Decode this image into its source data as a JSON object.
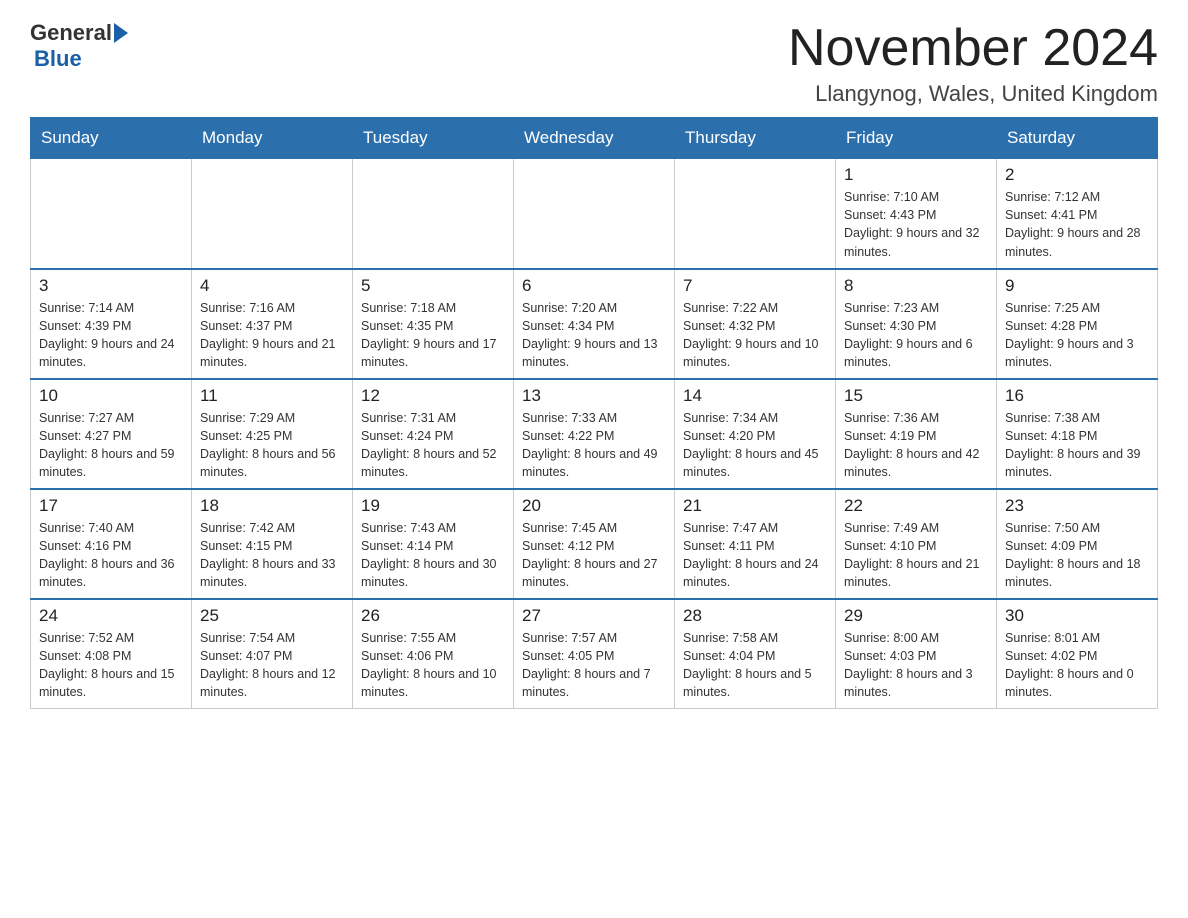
{
  "header": {
    "logo_general": "General",
    "logo_blue": "Blue",
    "month_title": "November 2024",
    "location": "Llangynog, Wales, United Kingdom"
  },
  "days_of_week": [
    "Sunday",
    "Monday",
    "Tuesday",
    "Wednesday",
    "Thursday",
    "Friday",
    "Saturday"
  ],
  "weeks": [
    [
      {
        "day": "",
        "info": ""
      },
      {
        "day": "",
        "info": ""
      },
      {
        "day": "",
        "info": ""
      },
      {
        "day": "",
        "info": ""
      },
      {
        "day": "",
        "info": ""
      },
      {
        "day": "1",
        "info": "Sunrise: 7:10 AM\nSunset: 4:43 PM\nDaylight: 9 hours and 32 minutes."
      },
      {
        "day": "2",
        "info": "Sunrise: 7:12 AM\nSunset: 4:41 PM\nDaylight: 9 hours and 28 minutes."
      }
    ],
    [
      {
        "day": "3",
        "info": "Sunrise: 7:14 AM\nSunset: 4:39 PM\nDaylight: 9 hours and 24 minutes."
      },
      {
        "day": "4",
        "info": "Sunrise: 7:16 AM\nSunset: 4:37 PM\nDaylight: 9 hours and 21 minutes."
      },
      {
        "day": "5",
        "info": "Sunrise: 7:18 AM\nSunset: 4:35 PM\nDaylight: 9 hours and 17 minutes."
      },
      {
        "day": "6",
        "info": "Sunrise: 7:20 AM\nSunset: 4:34 PM\nDaylight: 9 hours and 13 minutes."
      },
      {
        "day": "7",
        "info": "Sunrise: 7:22 AM\nSunset: 4:32 PM\nDaylight: 9 hours and 10 minutes."
      },
      {
        "day": "8",
        "info": "Sunrise: 7:23 AM\nSunset: 4:30 PM\nDaylight: 9 hours and 6 minutes."
      },
      {
        "day": "9",
        "info": "Sunrise: 7:25 AM\nSunset: 4:28 PM\nDaylight: 9 hours and 3 minutes."
      }
    ],
    [
      {
        "day": "10",
        "info": "Sunrise: 7:27 AM\nSunset: 4:27 PM\nDaylight: 8 hours and 59 minutes."
      },
      {
        "day": "11",
        "info": "Sunrise: 7:29 AM\nSunset: 4:25 PM\nDaylight: 8 hours and 56 minutes."
      },
      {
        "day": "12",
        "info": "Sunrise: 7:31 AM\nSunset: 4:24 PM\nDaylight: 8 hours and 52 minutes."
      },
      {
        "day": "13",
        "info": "Sunrise: 7:33 AM\nSunset: 4:22 PM\nDaylight: 8 hours and 49 minutes."
      },
      {
        "day": "14",
        "info": "Sunrise: 7:34 AM\nSunset: 4:20 PM\nDaylight: 8 hours and 45 minutes."
      },
      {
        "day": "15",
        "info": "Sunrise: 7:36 AM\nSunset: 4:19 PM\nDaylight: 8 hours and 42 minutes."
      },
      {
        "day": "16",
        "info": "Sunrise: 7:38 AM\nSunset: 4:18 PM\nDaylight: 8 hours and 39 minutes."
      }
    ],
    [
      {
        "day": "17",
        "info": "Sunrise: 7:40 AM\nSunset: 4:16 PM\nDaylight: 8 hours and 36 minutes."
      },
      {
        "day": "18",
        "info": "Sunrise: 7:42 AM\nSunset: 4:15 PM\nDaylight: 8 hours and 33 minutes."
      },
      {
        "day": "19",
        "info": "Sunrise: 7:43 AM\nSunset: 4:14 PM\nDaylight: 8 hours and 30 minutes."
      },
      {
        "day": "20",
        "info": "Sunrise: 7:45 AM\nSunset: 4:12 PM\nDaylight: 8 hours and 27 minutes."
      },
      {
        "day": "21",
        "info": "Sunrise: 7:47 AM\nSunset: 4:11 PM\nDaylight: 8 hours and 24 minutes."
      },
      {
        "day": "22",
        "info": "Sunrise: 7:49 AM\nSunset: 4:10 PM\nDaylight: 8 hours and 21 minutes."
      },
      {
        "day": "23",
        "info": "Sunrise: 7:50 AM\nSunset: 4:09 PM\nDaylight: 8 hours and 18 minutes."
      }
    ],
    [
      {
        "day": "24",
        "info": "Sunrise: 7:52 AM\nSunset: 4:08 PM\nDaylight: 8 hours and 15 minutes."
      },
      {
        "day": "25",
        "info": "Sunrise: 7:54 AM\nSunset: 4:07 PM\nDaylight: 8 hours and 12 minutes."
      },
      {
        "day": "26",
        "info": "Sunrise: 7:55 AM\nSunset: 4:06 PM\nDaylight: 8 hours and 10 minutes."
      },
      {
        "day": "27",
        "info": "Sunrise: 7:57 AM\nSunset: 4:05 PM\nDaylight: 8 hours and 7 minutes."
      },
      {
        "day": "28",
        "info": "Sunrise: 7:58 AM\nSunset: 4:04 PM\nDaylight: 8 hours and 5 minutes."
      },
      {
        "day": "29",
        "info": "Sunrise: 8:00 AM\nSunset: 4:03 PM\nDaylight: 8 hours and 3 minutes."
      },
      {
        "day": "30",
        "info": "Sunrise: 8:01 AM\nSunset: 4:02 PM\nDaylight: 8 hours and 0 minutes."
      }
    ]
  ]
}
